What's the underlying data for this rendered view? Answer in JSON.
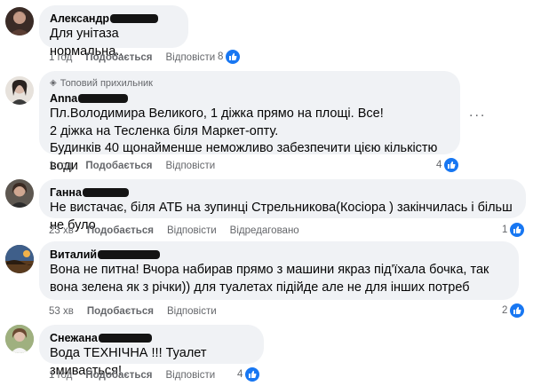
{
  "colors": {
    "bubble": "#f0f2f5",
    "secondary_text": "#65676b",
    "like_blue": "#1877f2"
  },
  "icons": {
    "like": "thumbs-up-icon",
    "top_fan": "diamond-badge-icon",
    "more": "more-options-icon"
  },
  "comments": [
    {
      "author": "Александр",
      "text": "Для унітаза нормальна..",
      "time": "1 год",
      "actions": {
        "reply": "Подобається",
        "respond": "Відповісти"
      },
      "likes": "8"
    },
    {
      "badge": "Топовий прихильник",
      "author": "Anna",
      "text": "Пл.Володимира Великого, 1 діжка прямо на площі. Все!\n2 діжка на Тесленка біля Маркет-опту.\nБудинків 40 щонайменше неможливо забезпечити цією кількістю води",
      "time": "1 год",
      "actions": {
        "reply": "Подобається",
        "respond": "Відповісти"
      },
      "likes": "4",
      "more": "..."
    },
    {
      "author": "Ганна",
      "text": "Не вистачає, біля АТБ на зупинці Стрельникова(Косіора ) закінчилась і більш не було",
      "time": "23 хв",
      "actions": {
        "reply": "Подобається",
        "respond": "Відповісти",
        "edited": "Відредаговано"
      },
      "likes": "1"
    },
    {
      "author": "Виталий",
      "text": "Вона не питна! Вчора набирав прямо з машини якраз під'їхала бочка, так вона зелена як з річки)) для туалетах підійде але не для інших потреб",
      "time": "53 хв",
      "actions": {
        "reply": "Подобається",
        "respond": "Відповісти"
      },
      "likes": "2"
    },
    {
      "author": "Снежана",
      "text": "Вода ТЕХНІЧНА !!! Туалет змивається!",
      "time": "1 год",
      "actions": {
        "reply": "Подобається",
        "respond": "Відповісти"
      },
      "likes": "4"
    }
  ]
}
